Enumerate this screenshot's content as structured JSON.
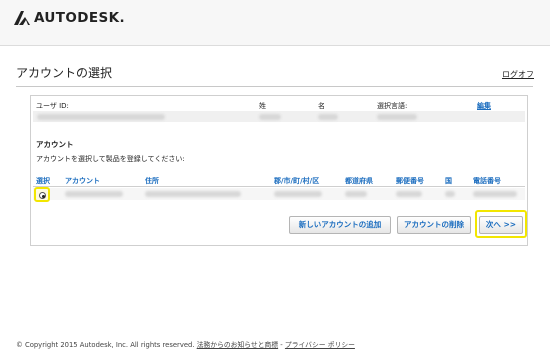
{
  "header": {
    "brand": "AUTODESK."
  },
  "page": {
    "title": "アカウントの選択",
    "logout": "ログオフ"
  },
  "user_table": {
    "headers": {
      "user_id": "ユーザ ID:",
      "last_name": "姓",
      "first_name": "名",
      "language": "選択言語:",
      "edit": "編集"
    }
  },
  "account_section": {
    "title": "アカウント",
    "description": "アカウントを選択して製品を登録してください:",
    "columns": [
      "選択",
      "アカウント",
      "住所",
      "郡/市/町/村/区",
      "都道府県",
      "郵便番号",
      "国",
      "電話番号"
    ]
  },
  "buttons": {
    "add_account": "新しいアカウントの追加",
    "delete_account": "アカウントの削除",
    "next": "次へ >>"
  },
  "footer": {
    "copyright": "© Copyright 2015 Autodesk, Inc. All rights reserved.",
    "legal_link": "法務からのお知らせと商標",
    "separator": "-",
    "privacy_link": "プライバシー ポリシー"
  },
  "colors": {
    "link_blue": "#1b6dbf",
    "highlight_yellow": "#f2e600",
    "brand_black": "#222222"
  }
}
